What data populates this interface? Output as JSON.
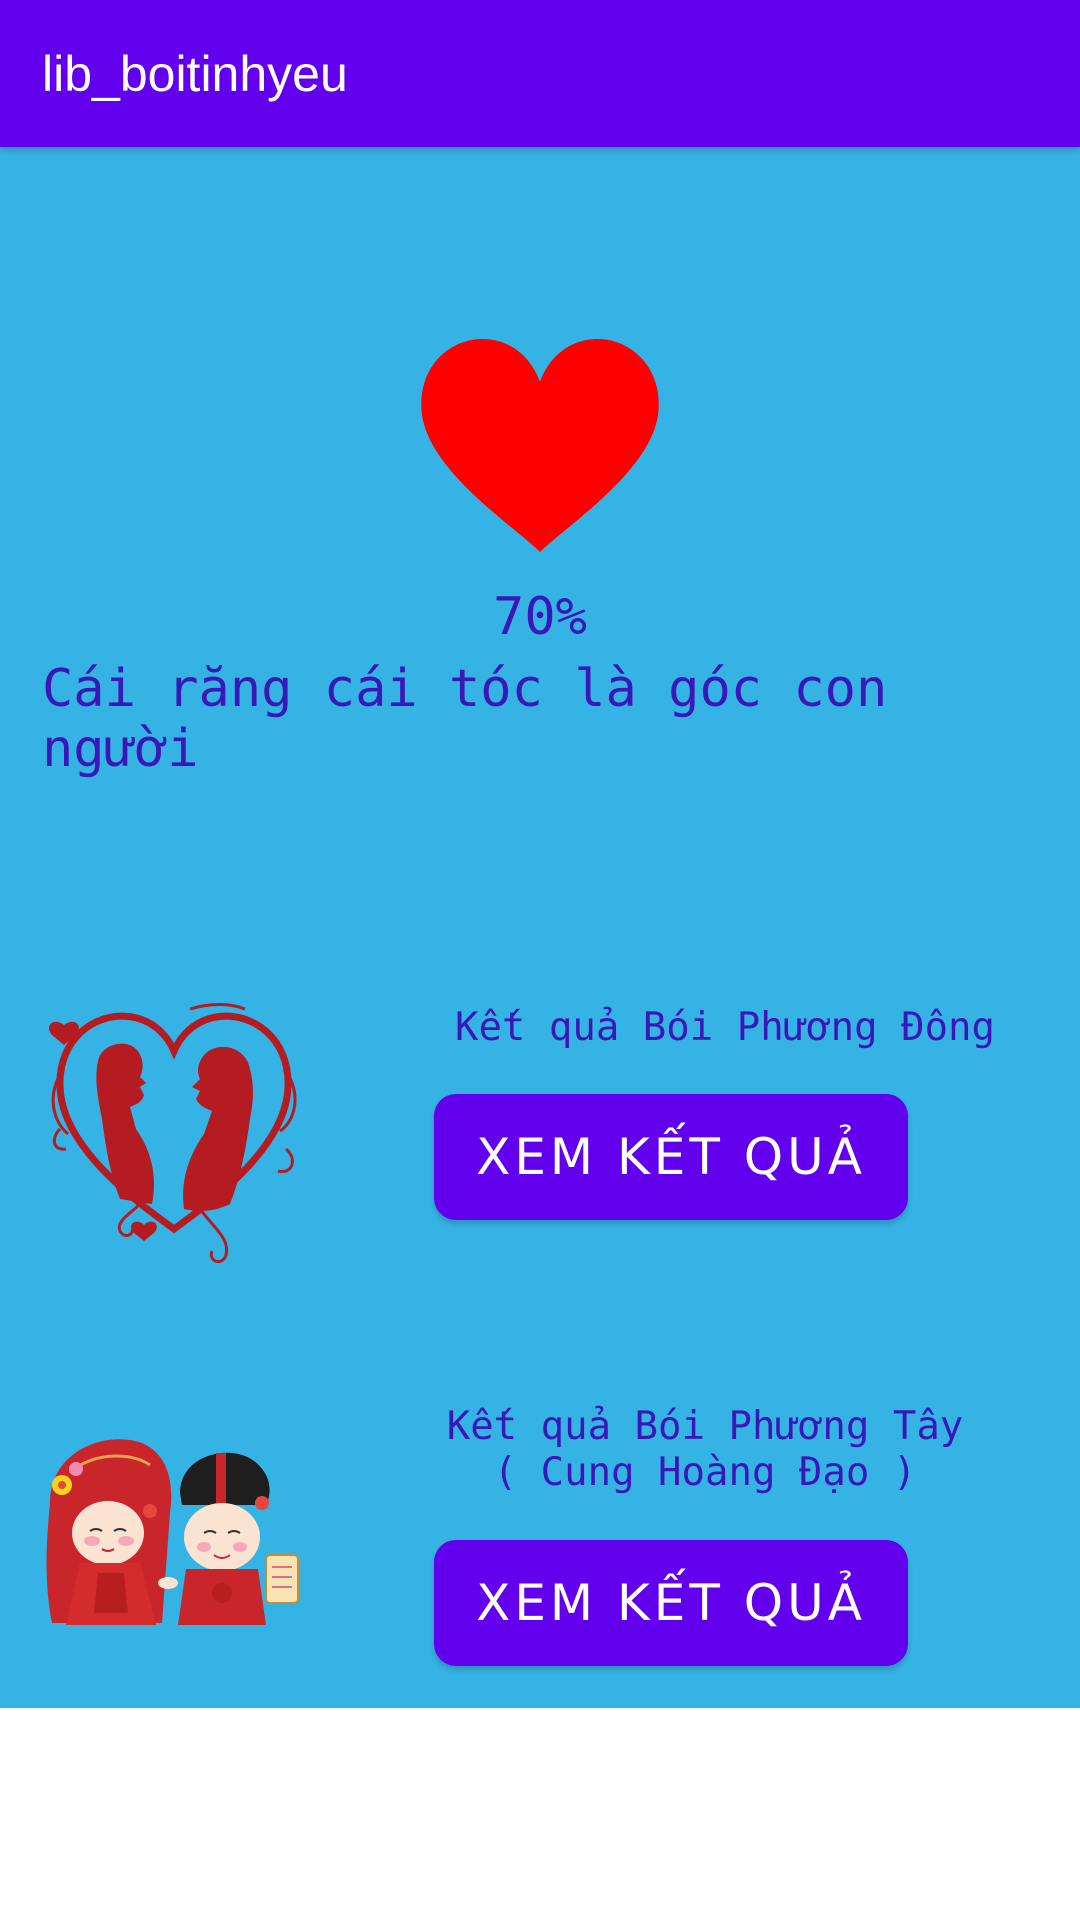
{
  "app_bar": {
    "title": "lib_boitinhyeu",
    "background_color": "#6200EE"
  },
  "result": {
    "percent": "70%",
    "quote": "Cái răng cái tóc là góc con người",
    "heart_icon": "heart-icon",
    "heart_color": "#FF0000"
  },
  "east_section": {
    "label": "Kết quả Bói Phương Đông",
    "button_label": "XEM KẾT QUẢ",
    "image": "kissing-couple-heart-image"
  },
  "west_section": {
    "label": "Kết quả Bói Phương Tây\n( Cung Hoàng Đạo )",
    "button_label": "XEM KẾT QUẢ",
    "image": "wedding-couple-cartoon-image"
  },
  "colors": {
    "content_background": "#36B3E5",
    "text_primary": "#3A18B7",
    "button": "#6200EE"
  }
}
